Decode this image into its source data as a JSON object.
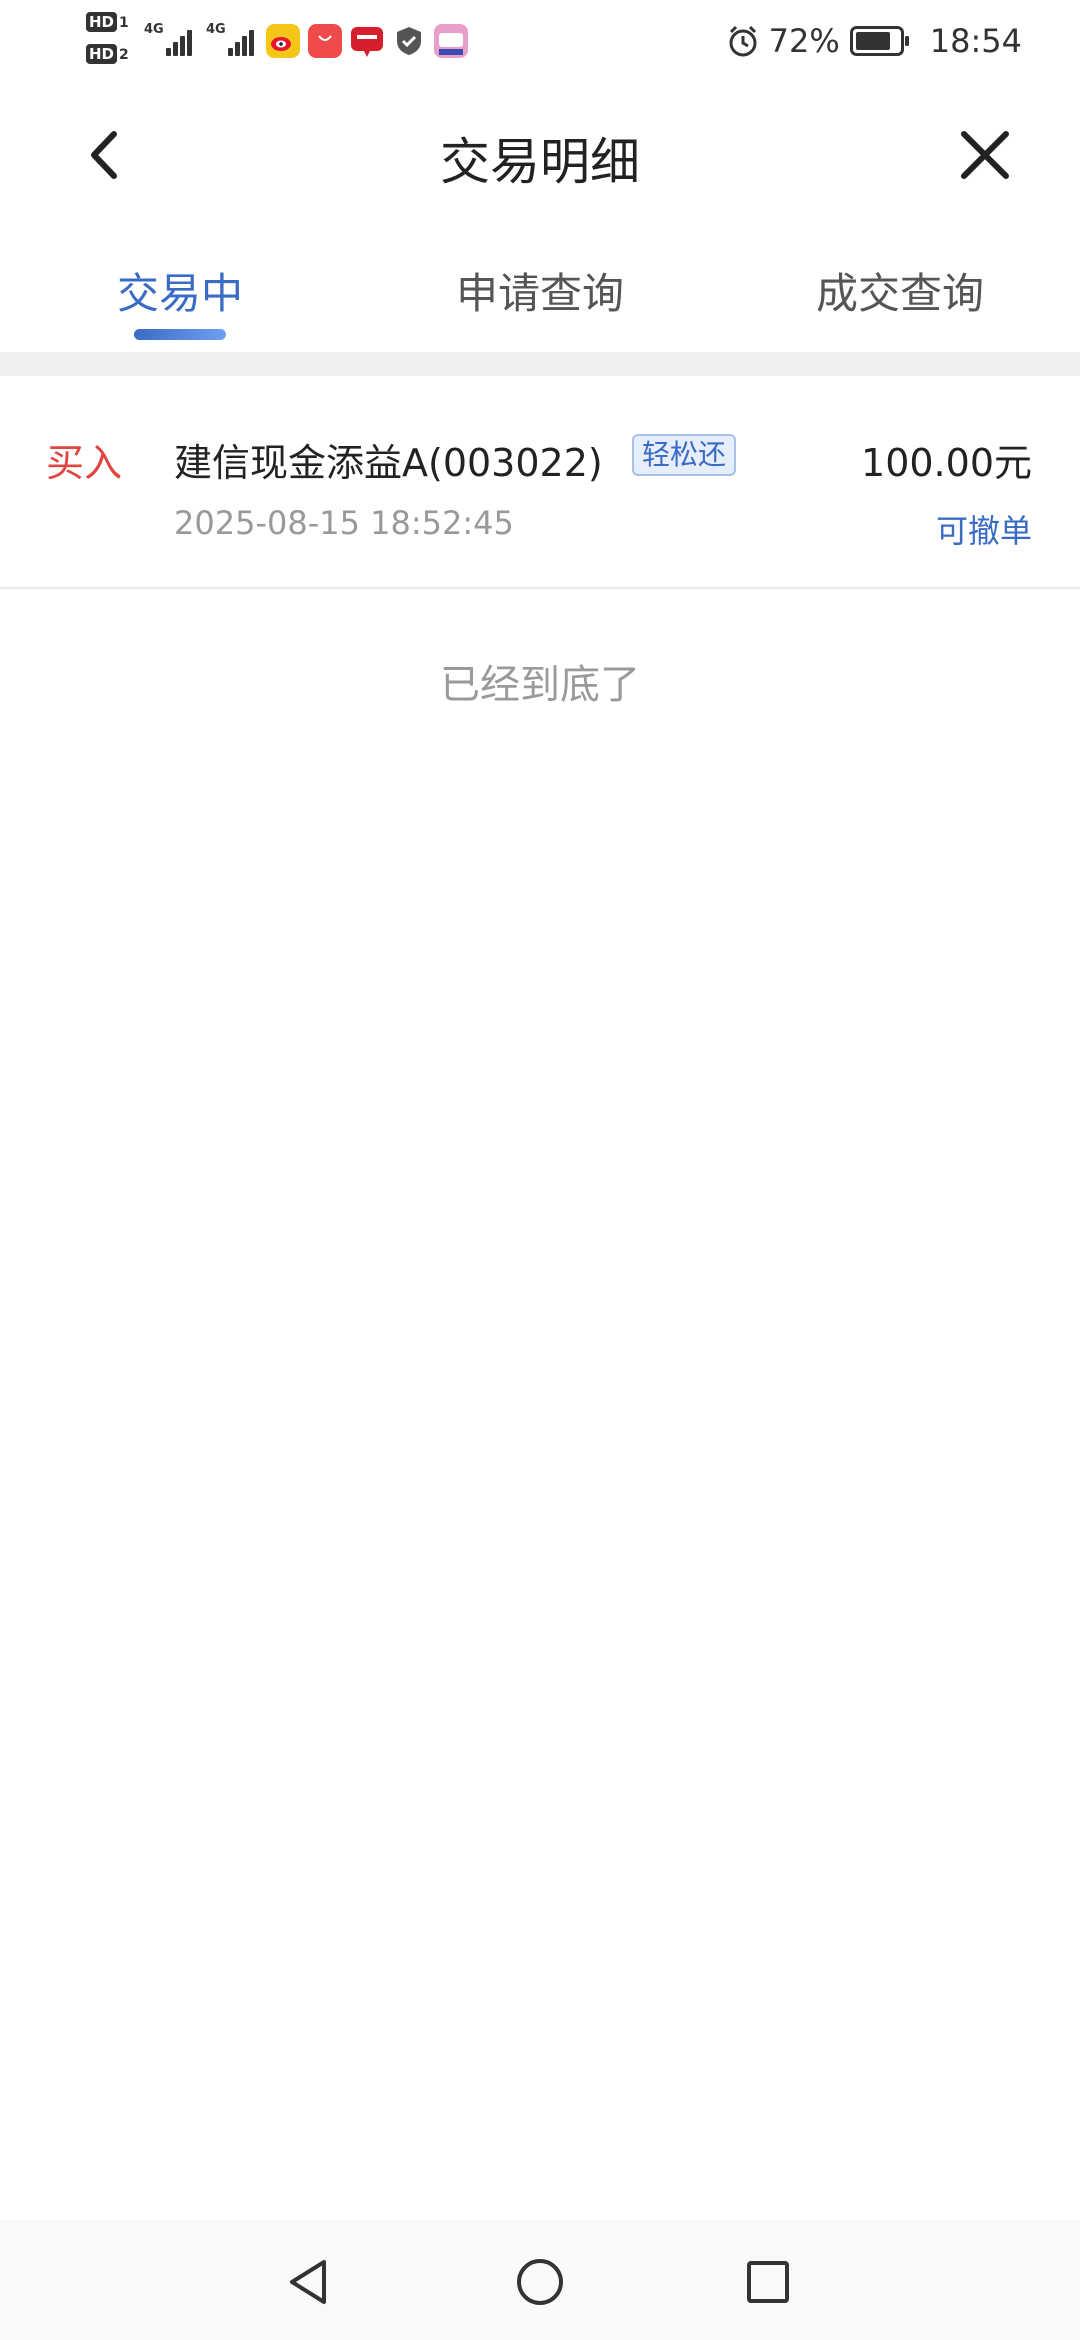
{
  "status_bar": {
    "sim1": "HD 1",
    "sim2": "HD 2",
    "network_1": "4G",
    "network_2": "4G",
    "battery_percent": "72%",
    "time": "18:54",
    "icons": [
      "weibo-icon",
      "huawei-appgallery-icon",
      "app-red-icon",
      "shield-icon",
      "bilibili-icon"
    ]
  },
  "header": {
    "title": "交易明细"
  },
  "tabs": [
    {
      "label": "交易中",
      "active": true
    },
    {
      "label": "申请查询",
      "active": false
    },
    {
      "label": "成交查询",
      "active": false
    }
  ],
  "orders": [
    {
      "type": "买入",
      "fund_name": "建信现金添益A(003022)",
      "tag": "轻松还",
      "time": "2025-08-15 18:52:45",
      "amount": "100.00元",
      "action": "可撤单"
    }
  ],
  "list_end_text": "已经到底了",
  "colors": {
    "accent_blue": "#3a6cc6",
    "buy_red": "#e0463f",
    "muted_gray": "#999999"
  }
}
